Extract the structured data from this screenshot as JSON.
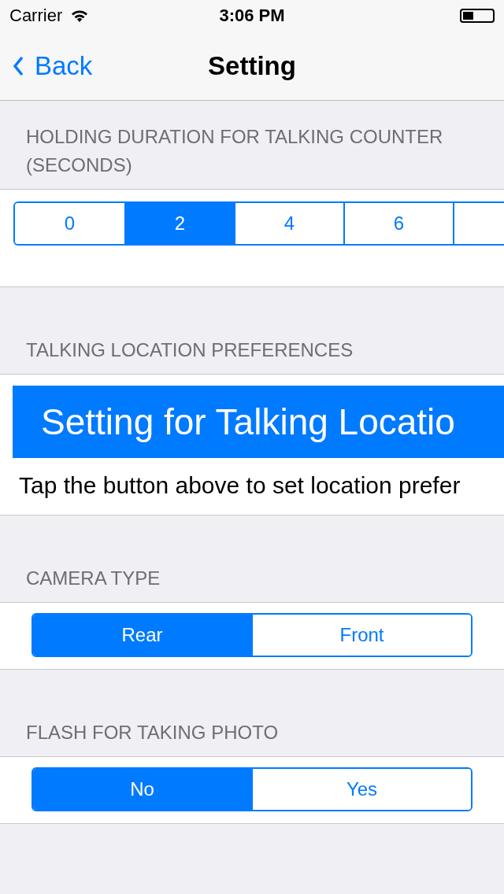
{
  "status_bar": {
    "carrier": "Carrier",
    "time": "3:06 PM"
  },
  "nav": {
    "back": "Back",
    "title": "Setting"
  },
  "sections": [
    {
      "kind": "segments",
      "header": "HOLDING DURATION FOR TALKING COUNTER (SECONDS)",
      "options": [
        {
          "label": "0",
          "selected": false
        },
        {
          "label": "2",
          "selected": true
        },
        {
          "label": "4",
          "selected": false
        },
        {
          "label": "6",
          "selected": false
        },
        {
          "selected": false
        }
      ]
    },
    {
      "kind": "button",
      "header": "TALKING LOCATION PREFERENCES",
      "button": "Setting for Talking Locatio",
      "note": "Tap the button above to set location prefer"
    },
    {
      "kind": "segments",
      "header": "CAMERA TYPE",
      "options": [
        {
          "label": "Rear",
          "selected": true
        },
        {
          "label": "Front",
          "selected": false
        }
      ]
    },
    {
      "kind": "segments",
      "header": "FLASH FOR TAKING PHOTO",
      "options": [
        {
          "label": "No",
          "selected": true
        },
        {
          "label": "Yes",
          "selected": false
        }
      ]
    }
  ]
}
